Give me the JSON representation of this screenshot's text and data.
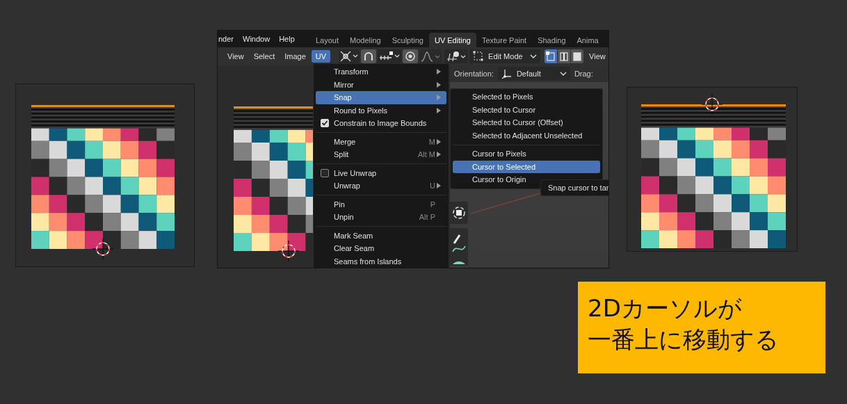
{
  "left_view": {
    "cursor_on_top": false
  },
  "editor": {
    "menu_bar": [
      "nder",
      "Window",
      "Help"
    ],
    "workspace_tabs": [
      {
        "label": "Layout",
        "selected": false
      },
      {
        "label": "Modeling",
        "selected": false
      },
      {
        "label": "Sculpting",
        "selected": false
      },
      {
        "label": "UV Editing",
        "selected": true
      },
      {
        "label": "Texture Paint",
        "selected": false
      },
      {
        "label": "Shading",
        "selected": false
      },
      {
        "label": "Anima",
        "selected": false
      }
    ],
    "header_menus": [
      {
        "label": "View",
        "selected": false
      },
      {
        "label": "Select",
        "selected": false
      },
      {
        "label": "Image",
        "selected": false
      },
      {
        "label": "UV",
        "selected": true
      }
    ],
    "mode_dropdown": "Edit Mode",
    "select_modes": [
      {
        "selected": true
      },
      {
        "selected": false
      },
      {
        "selected": false
      }
    ],
    "viewport_menu": "View",
    "orientation_label": "Orientation:",
    "orientation_value": "Default",
    "drag_label": "Drag:",
    "uv_view": {
      "cursor_on_top": false
    },
    "uv_menu": [
      [
        {
          "label": "Transform",
          "kind": "item",
          "submenu": true,
          "selected": false
        },
        {
          "label": "Mirror",
          "kind": "item",
          "submenu": true,
          "selected": false
        },
        {
          "label": "Snap",
          "kind": "item",
          "submenu": true,
          "selected": true
        },
        {
          "label": "Round to Pixels",
          "kind": "item",
          "submenu": true,
          "selected": false
        },
        {
          "label": "Constrain to Image Bounds",
          "kind": "checkbox",
          "checked": true,
          "selected": false
        }
      ],
      [
        {
          "label": "Merge",
          "kind": "item",
          "shortcut": "M",
          "submenu": true,
          "selected": false
        },
        {
          "label": "Split",
          "kind": "item",
          "shortcut": "Alt M",
          "submenu": true,
          "selected": false
        }
      ],
      [
        {
          "label": "Live Unwrap",
          "kind": "checkbox",
          "checked": false,
          "selected": false
        },
        {
          "label": "Unwrap",
          "kind": "item",
          "shortcut": "U",
          "submenu": true,
          "selected": false
        }
      ],
      [
        {
          "label": "Pin",
          "kind": "item",
          "shortcut": "P",
          "submenu": false,
          "selected": false
        },
        {
          "label": "Unpin",
          "kind": "item",
          "shortcut": "Alt P",
          "submenu": false,
          "selected": false
        }
      ],
      [
        {
          "label": "Mark Seam",
          "kind": "item",
          "submenu": false,
          "selected": false
        },
        {
          "label": "Clear Seam",
          "kind": "item",
          "submenu": false,
          "selected": false
        },
        {
          "label": "Seams from Islands",
          "kind": "item",
          "submenu": false,
          "selected": false
        }
      ]
    ],
    "snap_submenu": [
      [
        {
          "label": "Selected to Pixels",
          "selected": false
        },
        {
          "label": "Selected to Cursor",
          "selected": false
        },
        {
          "label": "Selected to Cursor (Offset)",
          "selected": false
        },
        {
          "label": "Selected to Adjacent Unselected",
          "selected": false
        }
      ],
      [
        {
          "label": "Cursor to Pixels",
          "selected": false
        },
        {
          "label": "Cursor to Selected",
          "selected": true
        },
        {
          "label": "Cursor to Origin",
          "selected": false
        }
      ]
    ],
    "tooltip": "Snap cursor to tar"
  },
  "right_view": {
    "cursor_on_top": true
  },
  "callout": {
    "lines": [
      "2Dカーソルが",
      "一番上に移動する"
    ]
  }
}
